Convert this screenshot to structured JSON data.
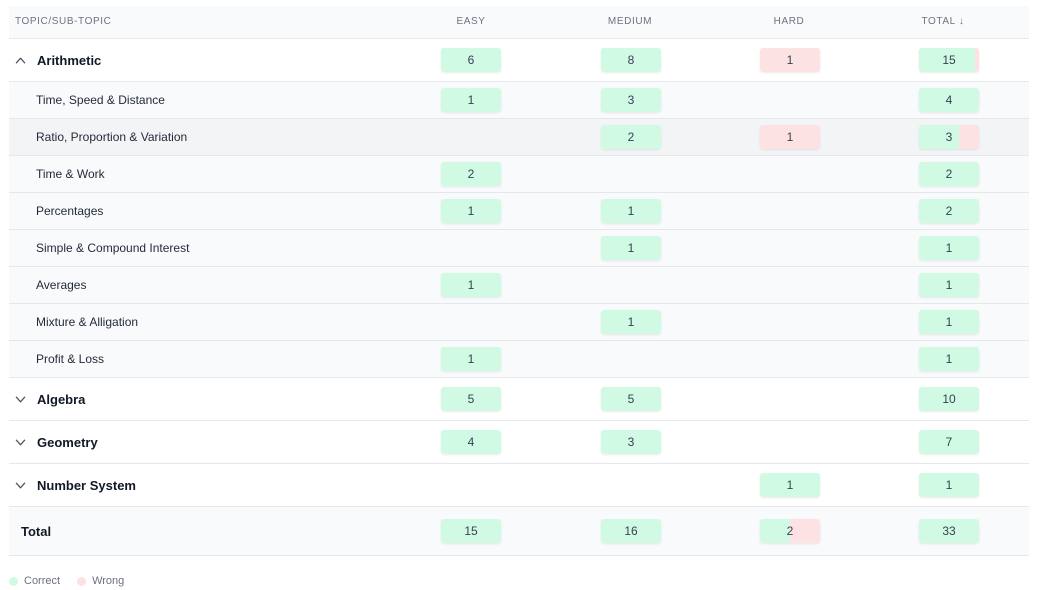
{
  "headers": {
    "topic": "TOPIC/SUB-TOPIC",
    "easy": "EASY",
    "medium": "MEDIUM",
    "hard": "HARD",
    "total": "TOTAL ↓"
  },
  "colors": {
    "correct": "#d1fae5",
    "wrong": "#fde2e4"
  },
  "rows": [
    {
      "kind": "main",
      "name": "Arithmetic",
      "expanded": true,
      "icon": "chevron-up-icon",
      "easy": {
        "v": "6",
        "w": 0
      },
      "medium": {
        "v": "8",
        "w": 0
      },
      "hard": {
        "v": "1",
        "w": 1
      },
      "total": {
        "v": "15",
        "w": 0.067
      }
    },
    {
      "kind": "sub",
      "name": "Time, Speed & Distance",
      "easy": {
        "v": "1",
        "w": 0
      },
      "medium": {
        "v": "3",
        "w": 0
      },
      "hard": null,
      "total": {
        "v": "4",
        "w": 0
      }
    },
    {
      "kind": "sub",
      "name": "Ratio, Proportion & Variation",
      "highlight": true,
      "easy": null,
      "medium": {
        "v": "2",
        "w": 0
      },
      "hard": {
        "v": "1",
        "w": 1
      },
      "total": {
        "v": "3",
        "w": 0.333
      }
    },
    {
      "kind": "sub",
      "name": "Time & Work",
      "easy": {
        "v": "2",
        "w": 0
      },
      "medium": null,
      "hard": null,
      "total": {
        "v": "2",
        "w": 0
      }
    },
    {
      "kind": "sub",
      "name": "Percentages",
      "easy": {
        "v": "1",
        "w": 0
      },
      "medium": {
        "v": "1",
        "w": 0
      },
      "hard": null,
      "total": {
        "v": "2",
        "w": 0
      }
    },
    {
      "kind": "sub",
      "name": "Simple & Compound Interest",
      "easy": null,
      "medium": {
        "v": "1",
        "w": 0
      },
      "hard": null,
      "total": {
        "v": "1",
        "w": 0
      }
    },
    {
      "kind": "sub",
      "name": "Averages",
      "easy": {
        "v": "1",
        "w": 0
      },
      "medium": null,
      "hard": null,
      "total": {
        "v": "1",
        "w": 0
      }
    },
    {
      "kind": "sub",
      "name": "Mixture & Alligation",
      "easy": null,
      "medium": {
        "v": "1",
        "w": 0
      },
      "hard": null,
      "total": {
        "v": "1",
        "w": 0
      }
    },
    {
      "kind": "sub",
      "name": "Profit & Loss",
      "easy": {
        "v": "1",
        "w": 0
      },
      "medium": null,
      "hard": null,
      "total": {
        "v": "1",
        "w": 0
      }
    },
    {
      "kind": "main",
      "name": "Algebra",
      "expanded": false,
      "icon": "chevron-down-icon",
      "easy": {
        "v": "5",
        "w": 0
      },
      "medium": {
        "v": "5",
        "w": 0
      },
      "hard": null,
      "total": {
        "v": "10",
        "w": 0
      }
    },
    {
      "kind": "main",
      "name": "Geometry",
      "expanded": false,
      "icon": "chevron-down-icon",
      "easy": {
        "v": "4",
        "w": 0
      },
      "medium": {
        "v": "3",
        "w": 0
      },
      "hard": null,
      "total": {
        "v": "7",
        "w": 0
      }
    },
    {
      "kind": "main",
      "name": "Number System",
      "expanded": false,
      "icon": "chevron-down-icon",
      "easy": null,
      "medium": null,
      "hard": {
        "v": "1",
        "w": 0
      },
      "total": {
        "v": "1",
        "w": 0
      }
    },
    {
      "kind": "total",
      "name": "Total",
      "easy": {
        "v": "15",
        "w": 0
      },
      "medium": {
        "v": "16",
        "w": 0
      },
      "hard": {
        "v": "2",
        "w": 0.5
      },
      "total": {
        "v": "33",
        "w": 0
      }
    }
  ],
  "legend": {
    "correct": "Correct",
    "wrong": "Wrong"
  }
}
